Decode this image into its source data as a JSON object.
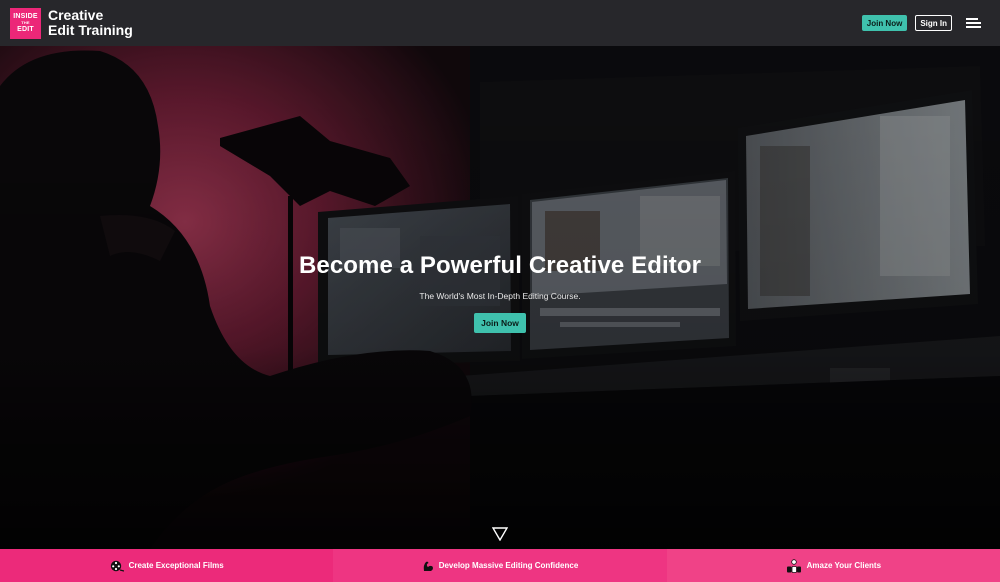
{
  "header": {
    "logo_lines": [
      "INSIDE",
      "THE",
      "EDIT"
    ],
    "brand_line1": "Creative",
    "brand_line2": "Edit Training",
    "join_label": "Join Now",
    "signin_label": "Sign In",
    "menu_icon": "hamburger-menu-icon"
  },
  "hero": {
    "title": "Become a Powerful Creative Editor",
    "subtitle": "The World's Most In-Depth Editing Course.",
    "cta_label": "Join Now",
    "scroll_icon": "down-triangle-icon"
  },
  "features": [
    {
      "label": "Create Exceptional Films",
      "icon": "film-reel-icon"
    },
    {
      "label": "Develop Massive Editing Confidence",
      "icon": "flexed-arm-icon"
    },
    {
      "label": "Amaze Your Clients",
      "icon": "audience-icon"
    }
  ],
  "colors": {
    "brand_pink": "#ec2778",
    "accent_teal": "#3fc1ad",
    "header_bg": "#27272b"
  }
}
